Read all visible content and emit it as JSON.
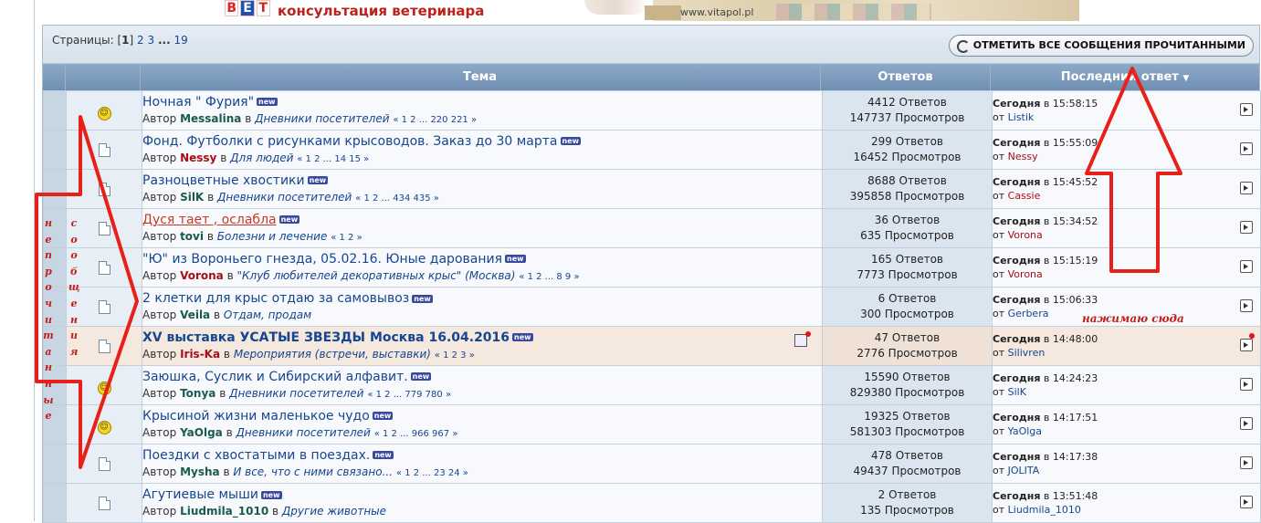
{
  "banner": {
    "vet_letters": [
      "В",
      "Е",
      "Т"
    ],
    "text": "консультация ветеринара",
    "url": "www.vitapol.pl"
  },
  "pagination": {
    "label": "Страницы:",
    "current": "1",
    "pages": [
      "2",
      "3"
    ],
    "ellipsis": "...",
    "last": "19"
  },
  "mark_all_button": "ОТМЕТИТЬ ВСЕ СООБЩЕНИЯ ПРОЧИТАННЫМИ",
  "columns": {
    "topic": "Тема",
    "replies": "Ответов",
    "last_reply": "Последний ответ"
  },
  "topics": [
    {
      "icon": "smile",
      "title": "Ночная \" Фурия\"",
      "author": "Messalina",
      "author_color": "green",
      "forum": "Дневники посетителей",
      "pages": "« 1 2 ... 220 221 »",
      "replies": "4412 Ответов",
      "views": "147737 Просмотров",
      "day": "Сегодня",
      "time": "в 15:58:15",
      "by": "от",
      "user": "Listik",
      "user_color": "blue"
    },
    {
      "icon": "doc",
      "title": "Фонд. Футболки с рисунками крысоводов. Заказ до 30 марта",
      "author": "Nessy",
      "author_color": "red",
      "forum": "Для людей",
      "pages": "« 1 2 ... 14 15 »",
      "replies": "299 Ответов",
      "views": "16452 Просмотров",
      "day": "Сегодня",
      "time": "в 15:55:09",
      "by": "от",
      "user": "Nessy",
      "user_color": "red"
    },
    {
      "icon": "doc",
      "title": "Разноцветные хвостики",
      "author": "SilK",
      "author_color": "green",
      "forum": "Дневники посетителей",
      "pages": "« 1 2 ... 434 435 »",
      "replies": "8688 Ответов",
      "views": "395858 Просмотров",
      "day": "Сегодня",
      "time": "в 15:45:52",
      "by": "от",
      "user": "Cassie",
      "user_color": "red"
    },
    {
      "icon": "doc",
      "title": "Дуся тает , ослабла",
      "author": "tovi",
      "author_color": "green",
      "forum": "Болезни и лечение",
      "pages": "« 1 2 »",
      "replies": "36 Ответов",
      "views": "635 Просмотров",
      "day": "Сегодня",
      "time": "в 15:34:52",
      "by": "от",
      "user": "Vorona",
      "user_color": "red",
      "selected": true
    },
    {
      "icon": "doc",
      "title": "\"Ю\" из Вороньего гнезда, 05.02.16. Юные дарования",
      "author": "Vorona",
      "author_color": "red",
      "forum": "\"Клуб любителей декоративных крыс\" (Москва)",
      "pages": "« 1 2 ... 8 9 »",
      "replies": "165 Ответов",
      "views": "7773 Просмотров",
      "day": "Сегодня",
      "time": "в 15:15:19",
      "by": "от",
      "user": "Vorona",
      "user_color": "red"
    },
    {
      "icon": "doc",
      "title": "2 клетки для крыс отдаю за самовывоз",
      "author": "Veila",
      "author_color": "green",
      "forum": "Отдам, продам",
      "pages": "",
      "replies": "6 Ответов",
      "views": "300 Просмотров",
      "day": "Сегодня",
      "time": "в 15:06:33",
      "by": "от",
      "user": "Gerbera",
      "user_color": "blue"
    },
    {
      "icon": "doc",
      "title": "XV выставка УСАТЫЕ ЗВЕЗДЫ Москва 16.04.2016",
      "author": "Iris-Ka",
      "author_color": "red",
      "forum": "Мероприятия (встречи, выставки)",
      "pages": "« 1 2 3 »",
      "replies": "47 Ответов",
      "views": "2776 Просмотров",
      "day": "Сегодня",
      "time": "в 14:48:00",
      "by": "от",
      "user": "Silivren",
      "user_color": "blue",
      "highlight": true
    },
    {
      "icon": "smile",
      "title": "Заюшка, Суслик и Сибирский алфавит.",
      "author": "Tonya",
      "author_color": "green",
      "forum": "Дневники посетителей",
      "pages": "« 1 2 ... 779 780 »",
      "replies": "15590 Ответов",
      "views": "829380 Просмотров",
      "day": "Сегодня",
      "time": "в 14:24:23",
      "by": "от",
      "user": "SilK",
      "user_color": "blue"
    },
    {
      "icon": "smile",
      "title": "Крысиной жизни маленькое чудо",
      "author": "YaOlga",
      "author_color": "green",
      "forum": "Дневники посетителей",
      "pages": "« 1 2 ... 966 967 »",
      "replies": "19325 Ответов",
      "views": "581303 Просмотров",
      "day": "Сегодня",
      "time": "в 14:17:51",
      "by": "от",
      "user": "YaOlga",
      "user_color": "blue"
    },
    {
      "icon": "doc",
      "title": "Поездки с хвостатыми в поездах.",
      "author": "Mysha",
      "author_color": "green",
      "forum": "И все, что с ними связано...",
      "pages": "« 1 2 ... 23 24 »",
      "replies": "478 Ответов",
      "views": "49437 Просмотров",
      "day": "Сегодня",
      "time": "в 14:17:38",
      "by": "от",
      "user": "JOLITA",
      "user_color": "blue"
    },
    {
      "icon": "doc",
      "title": "Агутиевые мыши",
      "author": "Liudmila_1010",
      "author_color": "green",
      "forum": "Другие животные",
      "pages": "",
      "replies": "2 Ответов",
      "views": "135 Просмотров",
      "day": "Сегодня",
      "time": "в 13:51:48",
      "by": "от",
      "user": "Liudmila_1010",
      "user_color": "blue"
    }
  ],
  "strings": {
    "author_prefix": "Автор",
    "in": "в",
    "new_badge": "new"
  },
  "annotations": {
    "vertical_text_1": [
      "н",
      "е",
      "п",
      "р",
      "о",
      "ч",
      "и",
      "т",
      "а",
      "н",
      "н",
      "ы",
      "е"
    ],
    "vertical_text_2": [
      "с",
      "о",
      "о",
      "б",
      "щ",
      "е",
      "н",
      "и",
      "я"
    ],
    "note": "нажимаю сюда",
    "color": "#e8201a"
  }
}
